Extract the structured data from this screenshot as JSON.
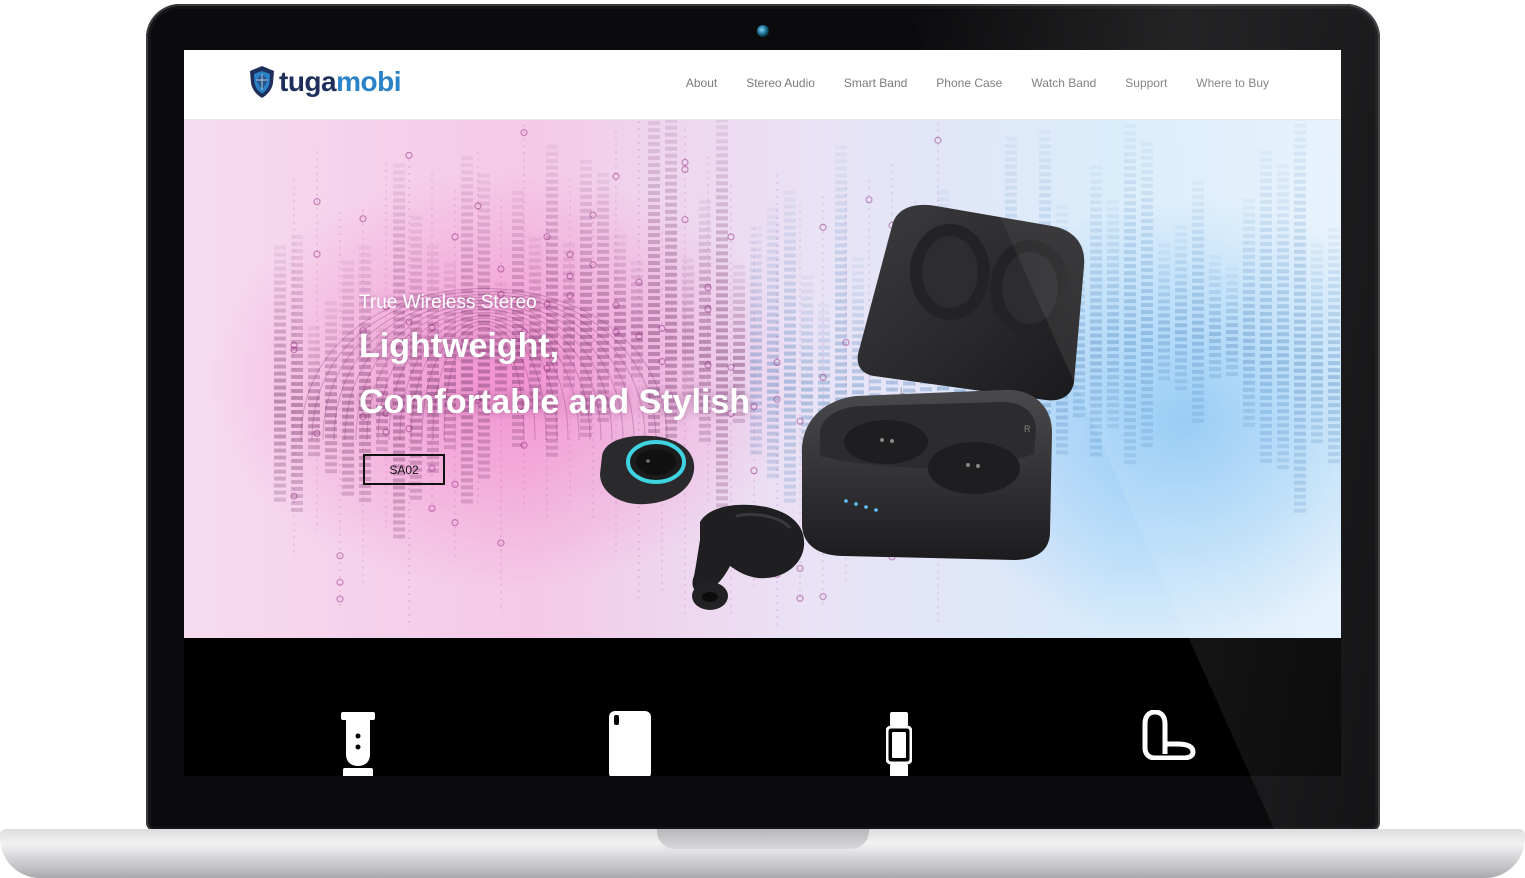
{
  "brand": {
    "name_part1": "tuga",
    "name_part2": "mobi",
    "logo_icon": "shield-icon",
    "colors": {
      "dark": "#1f2f5c",
      "accent": "#2a82c9"
    }
  },
  "nav": {
    "items": [
      {
        "label": "About"
      },
      {
        "label": "Stereo Audio"
      },
      {
        "label": "Smart Band"
      },
      {
        "label": "Phone Case"
      },
      {
        "label": "Watch Band"
      },
      {
        "label": "Support"
      },
      {
        "label": "Where to Buy"
      }
    ]
  },
  "hero": {
    "subtitle": "True Wireless Stereo",
    "title_line1": "Lightweight,",
    "title_line2": "Comfortable and Stylish",
    "button_label": "SA02",
    "product_image": "wireless-earbuds-with-charging-case"
  },
  "categories": {
    "items": [
      {
        "icon": "watch-strap-icon"
      },
      {
        "icon": "phone-case-icon"
      },
      {
        "icon": "smart-band-icon"
      },
      {
        "icon": "earbuds-icon"
      }
    ]
  }
}
